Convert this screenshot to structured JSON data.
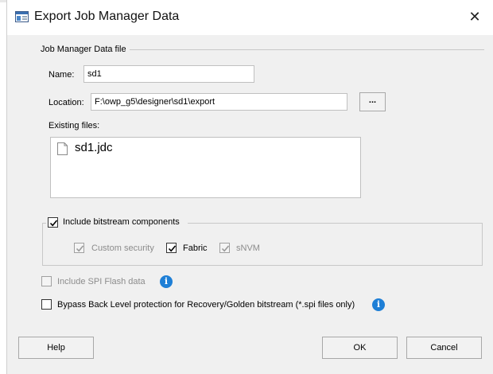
{
  "window": {
    "title": "Export Job Manager Data"
  },
  "data_file_group": {
    "label": "Job Manager Data file"
  },
  "name": {
    "label": "Name:",
    "value": "sd1"
  },
  "location": {
    "label": "Location:",
    "value": "F:\\owp_g5\\designer\\sd1\\export",
    "browse_label": "..."
  },
  "existing_files": {
    "label": "Existing files:",
    "files": [
      "sd1.jdc"
    ]
  },
  "bitstream": {
    "label": "Include bitstream components",
    "checked": true,
    "components": [
      {
        "label": "Custom security",
        "checked": true,
        "enabled": false
      },
      {
        "label": "Fabric",
        "checked": true,
        "enabled": true
      },
      {
        "label": "sNVM",
        "checked": true,
        "enabled": false
      }
    ]
  },
  "spi_flash": {
    "label": "Include SPI Flash data",
    "checked": false,
    "enabled": false
  },
  "bypass": {
    "label": "Bypass Back Level protection for Recovery/Golden bitstream (*.spi files only)",
    "checked": false
  },
  "buttons": {
    "help": "Help",
    "ok": "OK",
    "cancel": "Cancel"
  },
  "colors": {
    "info_icon": "#1e7fd6",
    "dialog_bg": "#f0f0f0"
  },
  "icons": {
    "app": "window-app-icon",
    "close": "close-icon",
    "info": "info-icon",
    "file": "file-icon",
    "check": "checkmark-icon"
  }
}
